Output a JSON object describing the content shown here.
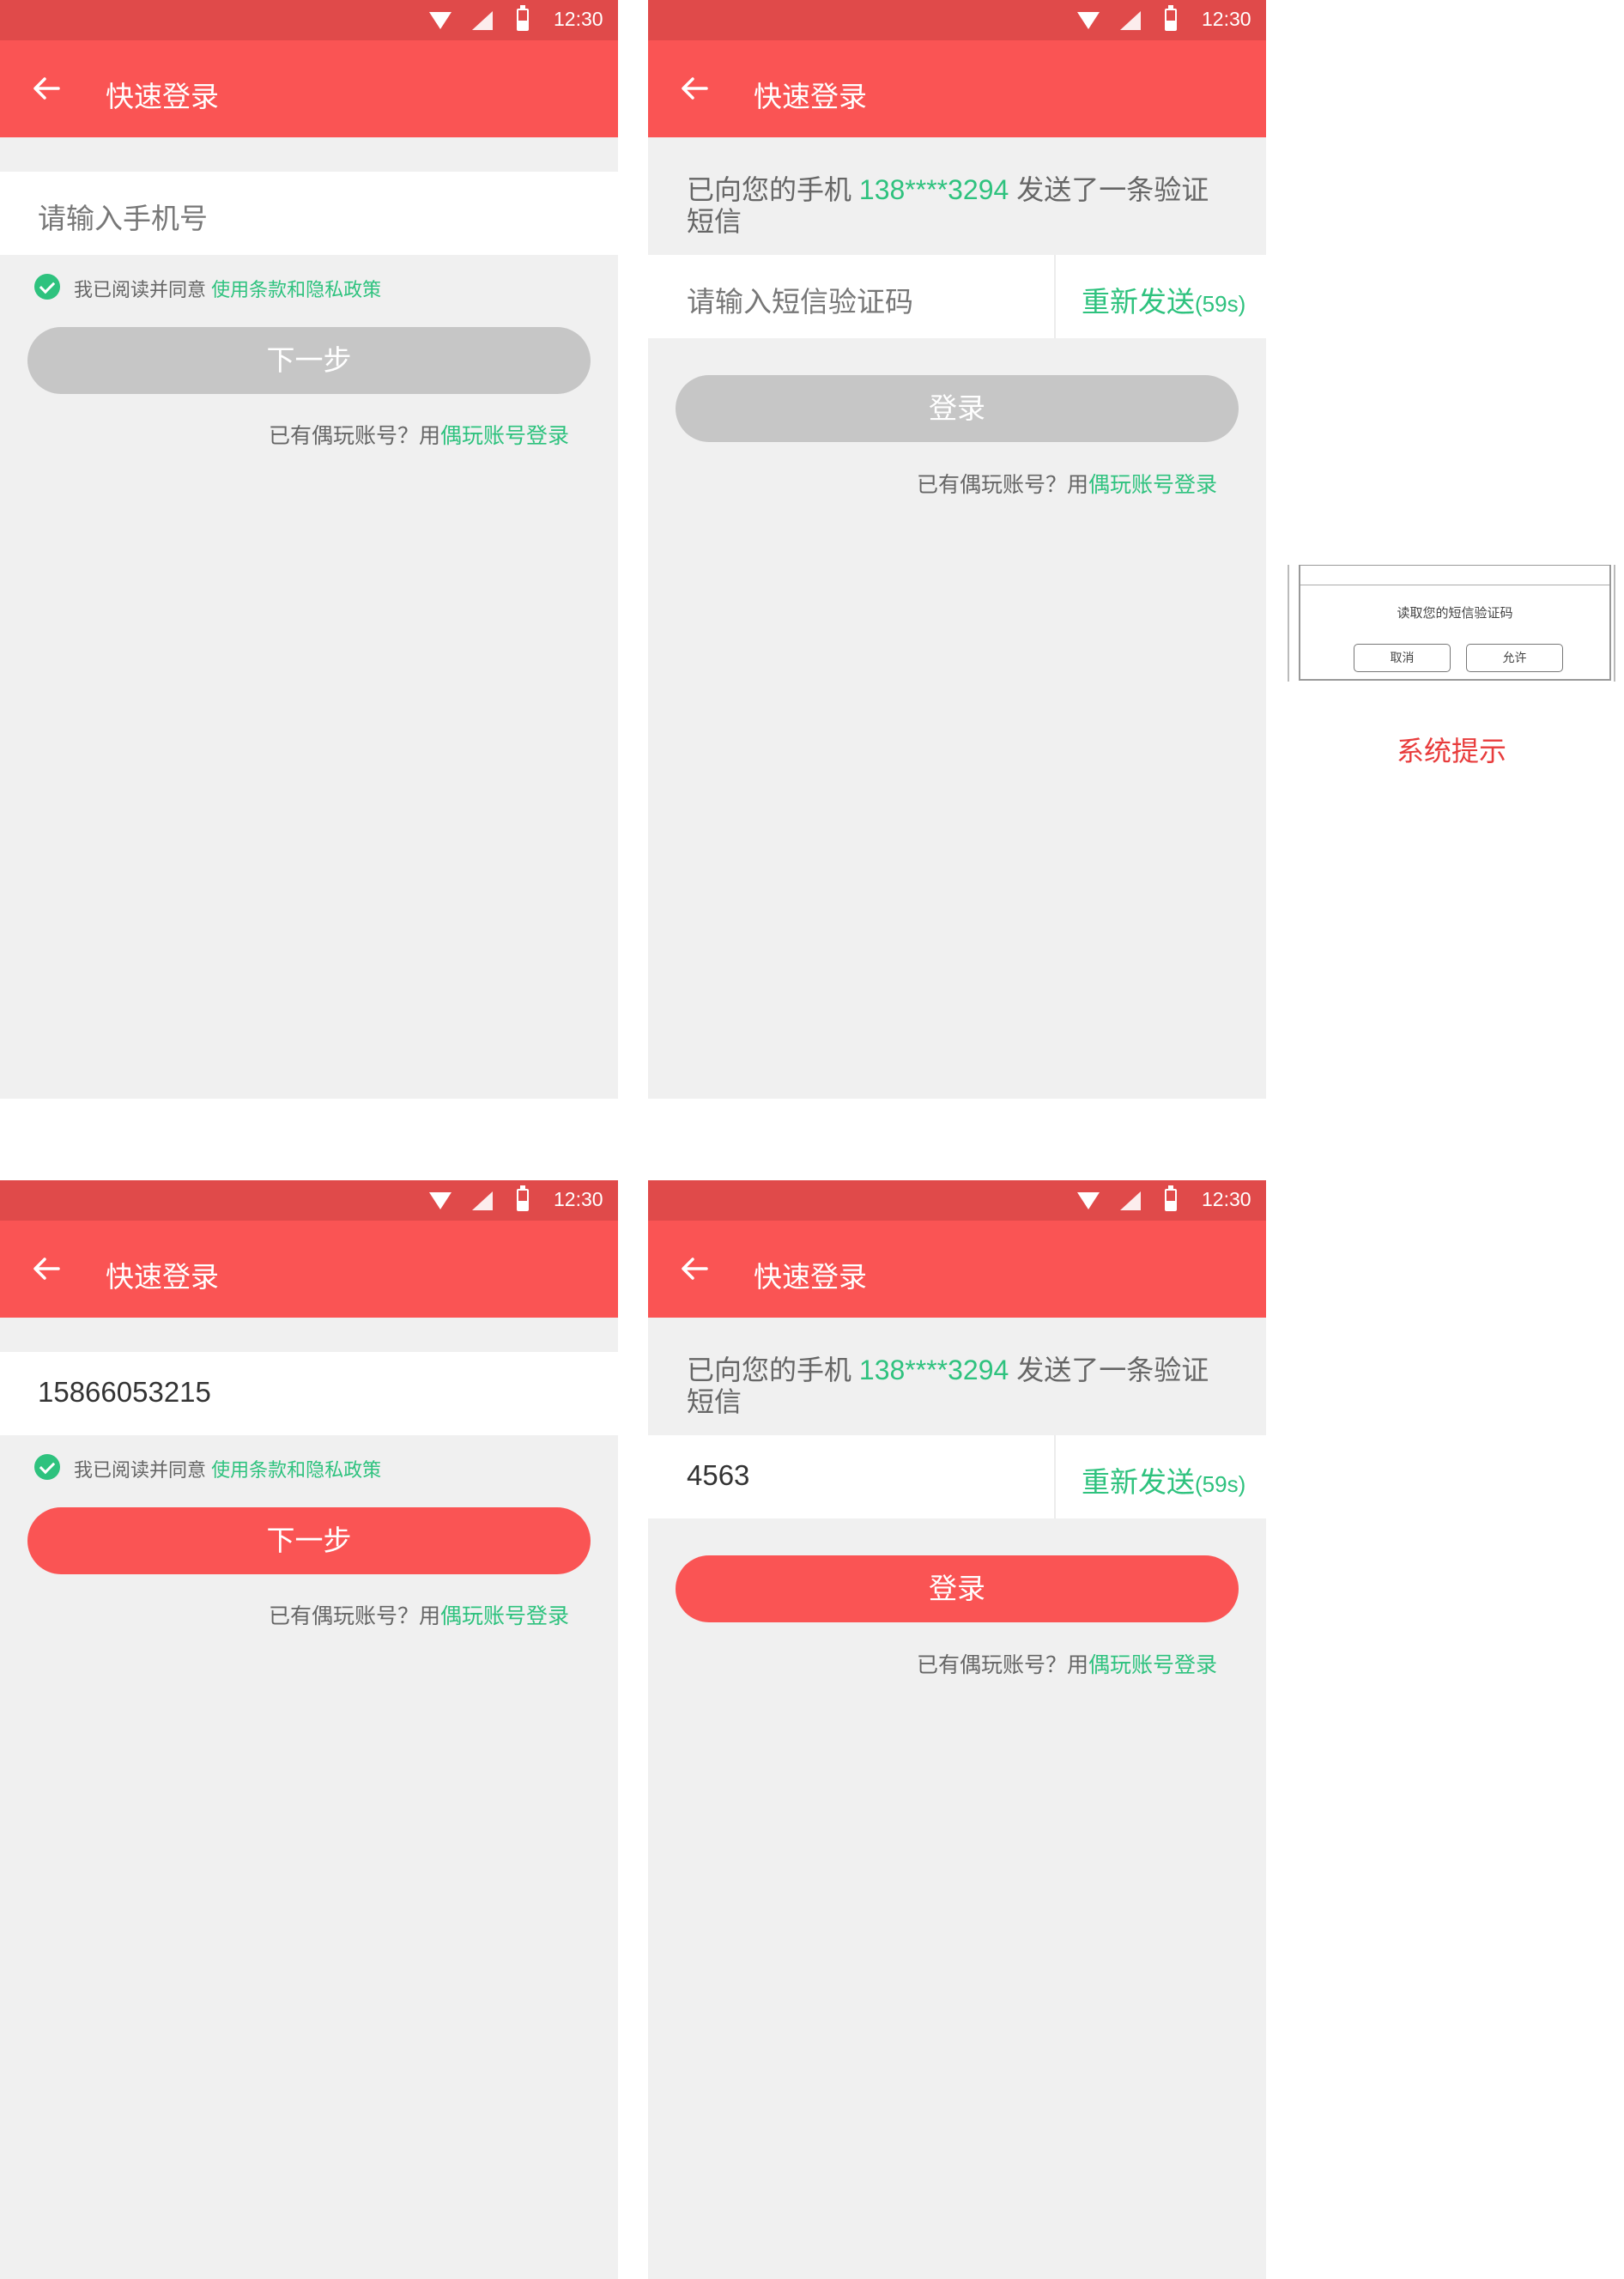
{
  "status": {
    "time": "12:30"
  },
  "appbar": {
    "title": "快速登录"
  },
  "phone_step": {
    "placeholder": "请输入手机号",
    "filled_value": "15866053215",
    "agree_text": "我已阅读并同意",
    "agree_link": "使用条款和隐私政策",
    "next_label": "下一步"
  },
  "alt_login": {
    "prefix": "已有偶玩账号？用",
    "link": "偶玩账号登录"
  },
  "code_step": {
    "msg_prefix": "已向您的手机 ",
    "masked_phone": "138****3294",
    "msg_suffix": " 发送了一条验证短信",
    "placeholder": "请输入短信验证码",
    "filled_value": "4563",
    "resend_label": "重新发送",
    "resend_countdown": "(59s)",
    "login_label": "登录"
  },
  "system_prompt": {
    "message": "读取您的短信验证码",
    "cancel_label": "取消",
    "allow_label": "允许",
    "caption": "系统提示"
  },
  "colors": {
    "primary": "#fa5454",
    "statusbar": "#e04a4a",
    "accent_green": "#2ec27e",
    "disabled": "#c6c6c6",
    "background": "#f0f0f0"
  }
}
